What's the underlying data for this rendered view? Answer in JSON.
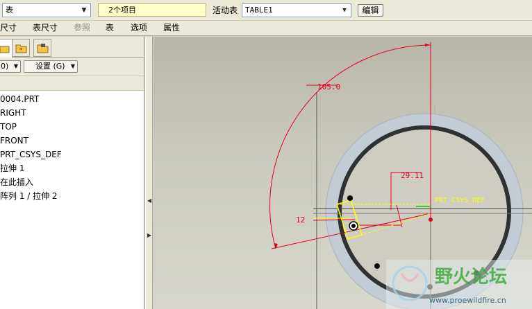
{
  "toolbar": {
    "table_combo_value": "表",
    "items_field": "2个项目",
    "active_table_label": "活动表",
    "active_table_value": "TABLE1",
    "edit_button": "编辑"
  },
  "menu": {
    "items": [
      "尺寸",
      "表尺寸",
      "参照",
      "表",
      "选项",
      "属性"
    ]
  },
  "left_panel": {
    "filter_button": "0)",
    "settings_button": "设置 (G)",
    "tree_items": [
      "0004.PRT",
      "RIGHT",
      "TOP",
      "FRONT",
      "PRT_CSYS_DEF",
      "拉伸 1",
      "在此插入",
      "阵列 1 / 拉伸 2"
    ]
  },
  "graphics": {
    "angle_dim": "105.0",
    "radius_dim": "29.11",
    "small_dim": "12",
    "csys_label": "PRT_CSYS_DEF"
  },
  "watermark": {
    "title": "野火论坛",
    "url": "www.proewildfire.cn"
  },
  "colors": {
    "dimension": "#e0001a",
    "ring": "#c3ccd5",
    "highlight": "#ffff00"
  }
}
